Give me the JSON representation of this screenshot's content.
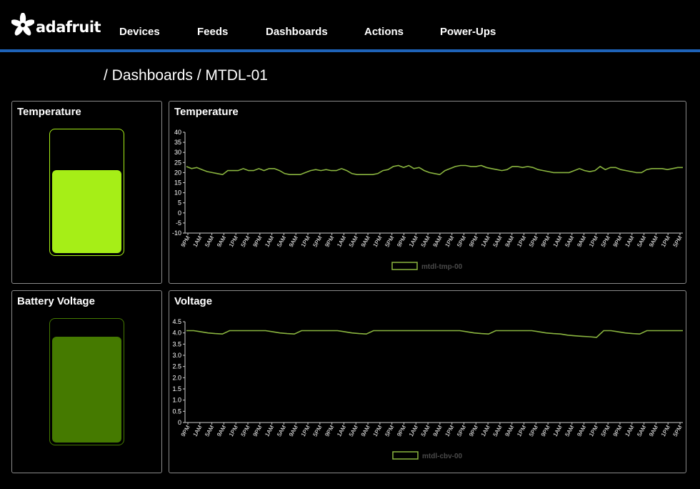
{
  "app": {
    "logo_text": "adafruit",
    "nav": [
      "Devices",
      "Feeds",
      "Dashboards",
      "Actions",
      "Power-Ups"
    ]
  },
  "breadcrumb": "/ Dashboards / MTDL-01",
  "colors": {
    "accent": "#1e63b8",
    "line": "#8ab53f",
    "gauge_temp": "#a6ee17",
    "gauge_batt": "#457a00",
    "border": "#8a8a8a"
  },
  "gauges": {
    "temperature": {
      "title": "Temperature",
      "level": 0.68
    },
    "battery": {
      "title": "Battery Voltage",
      "level": 0.87
    }
  },
  "charts": {
    "temperature": {
      "title": "Temperature"
    },
    "voltage": {
      "title": "Voltage"
    }
  },
  "chart_data": [
    {
      "type": "line",
      "title": "Temperature",
      "ylim": [
        -10,
        40
      ],
      "yticks": [
        "40",
        "35",
        "30",
        "25",
        "20",
        "15",
        "10",
        "5",
        "0",
        "-5",
        "-10"
      ],
      "xticks": [
        "9PM",
        "1AM",
        "5AM",
        "9AM",
        "1PM",
        "5PM",
        "9PM",
        "1AM",
        "5AM",
        "9AM",
        "1PM",
        "5PM",
        "9PM",
        "1AM",
        "5AM",
        "9AM",
        "1PM",
        "5PM",
        "9PM",
        "1AM",
        "5AM",
        "9AM",
        "1PM",
        "5PM",
        "9PM",
        "1AM",
        "5AM",
        "9AM",
        "1PM",
        "5PM",
        "9PM",
        "1AM",
        "5AM",
        "9AM",
        "1PM",
        "5PM",
        "9PM",
        "1AM",
        "5AM",
        "9AM",
        "1PM",
        "5PM"
      ],
      "legend": "mtdl-tmp-00",
      "series": [
        {
          "name": "mtdl-tmp-00",
          "values": [
            23,
            22,
            22.5,
            21.5,
            20.5,
            20,
            19.5,
            19,
            21,
            21,
            21,
            22,
            21,
            21,
            22,
            21,
            22,
            22,
            21,
            19.5,
            19,
            19,
            19,
            20,
            21,
            21.5,
            21,
            21.5,
            21,
            21,
            22,
            21,
            19.5,
            19,
            19,
            19,
            19,
            19.5,
            21,
            21.5,
            23,
            23.5,
            22.5,
            23.5,
            22,
            22.5,
            21,
            20,
            19.5,
            19,
            21,
            22,
            23,
            23.5,
            23.5,
            23,
            23,
            23.5,
            22.5,
            22,
            21.5,
            21,
            21.5,
            23,
            23,
            22.5,
            23,
            22.5,
            21.5,
            21,
            20.5,
            20,
            20,
            20,
            20,
            21,
            22,
            21,
            20.5,
            21,
            23,
            21.5,
            22.5,
            22.5,
            21.5,
            21,
            20.5,
            20,
            20,
            21.5,
            22,
            22,
            22,
            21.5,
            22,
            22.5,
            22.5
          ]
        }
      ]
    },
    {
      "type": "line",
      "title": "Voltage",
      "ylim": [
        0,
        4.5
      ],
      "yticks": [
        "4.5",
        "4.0",
        "3.5",
        "3.0",
        "2.5",
        "2.0",
        "1.5",
        "1.0",
        "0.5",
        "0"
      ],
      "xticks": [
        "9PM",
        "1AM",
        "5AM",
        "9AM",
        "1PM",
        "5PM",
        "9PM",
        "1AM",
        "5AM",
        "9AM",
        "1PM",
        "5PM",
        "9PM",
        "1AM",
        "5AM",
        "9AM",
        "1PM",
        "5PM",
        "9PM",
        "1AM",
        "5AM",
        "9AM",
        "1PM",
        "5PM",
        "9PM",
        "1AM",
        "5AM",
        "9AM",
        "1PM",
        "5PM",
        "9PM",
        "1AM",
        "5AM",
        "9AM",
        "1PM",
        "5PM",
        "9PM",
        "1AM",
        "5AM",
        "9AM",
        "1PM",
        "5PM"
      ],
      "legend": "mtdl-cbv-00",
      "series": [
        {
          "name": "mtdl-cbv-00",
          "values": [
            4.1,
            4.1,
            4.05,
            4.0,
            3.97,
            3.95,
            4.1,
            4.1,
            4.1,
            4.1,
            4.1,
            4.1,
            4.05,
            4.0,
            3.97,
            3.95,
            4.1,
            4.1,
            4.1,
            4.1,
            4.1,
            4.1,
            4.05,
            4.0,
            3.97,
            3.95,
            4.1,
            4.1,
            4.1,
            4.1,
            4.1,
            4.1,
            4.1,
            4.1,
            4.1,
            4.1,
            4.1,
            4.1,
            4.1,
            4.05,
            4.0,
            3.97,
            3.95,
            4.1,
            4.1,
            4.1,
            4.1,
            4.1,
            4.1,
            4.05,
            4.0,
            3.97,
            3.95,
            3.9,
            3.87,
            3.85,
            3.83,
            3.8,
            4.1,
            4.1,
            4.05,
            4.0,
            3.97,
            3.95,
            4.1,
            4.1,
            4.1,
            4.1,
            4.1,
            4.1
          ]
        }
      ]
    }
  ]
}
